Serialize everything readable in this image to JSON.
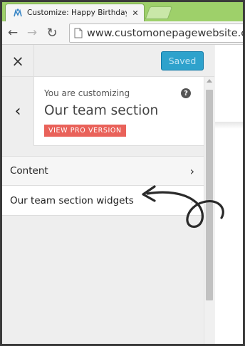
{
  "browser": {
    "tab_title": "Customize: Happy Birthday",
    "tab_close": "✕",
    "url": "www.customonepagewebsite.co",
    "nav": {
      "back": "←",
      "forward": "→",
      "reload": "↻"
    }
  },
  "customizer": {
    "close_label": "×",
    "save_button": "Saved",
    "back_label": "‹",
    "customizing_label": "You are customizing",
    "help_label": "?",
    "section_title": "Our team section",
    "pro_badge": "VIEW PRO VERSION",
    "items": [
      {
        "label": "Content",
        "chevron": "›"
      },
      {
        "label": "Our team section widgets",
        "chevron": "›"
      }
    ]
  },
  "colors": {
    "tab_strip": "#9ed06a",
    "saved_button": "#2ea2cc",
    "pro_badge": "#e9625a"
  },
  "icons": {
    "favicon": "wordpress-customize-icon",
    "help": "question-circle-icon",
    "annotation": "hand-drawn-arrow-icon"
  }
}
